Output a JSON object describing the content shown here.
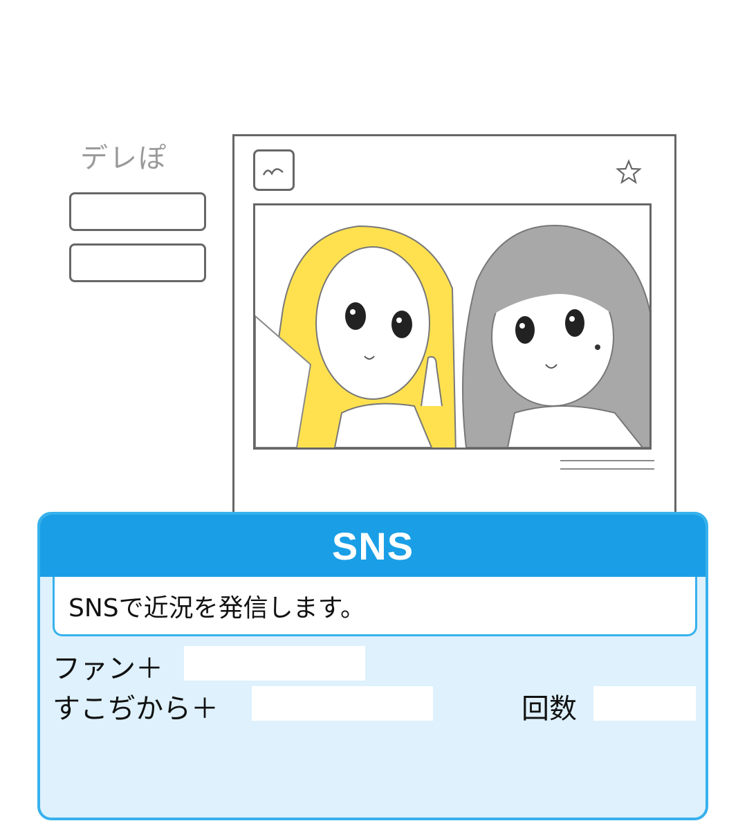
{
  "sketch": {
    "logo_text": "デレぽ"
  },
  "panel": {
    "title": "SNS",
    "description": "SNSで近況を発信します。",
    "fans_label": "ファン＋",
    "fans_value": "",
    "sukoshi_label": "すこぢから＋",
    "sukoshi_value": "",
    "count_label": "回数",
    "count_value": ""
  },
  "colors": {
    "header": "#1a9fe6",
    "border": "#37b1ec",
    "panel_bg": "#def1fc",
    "hair_blonde": "#ffe14f",
    "hair_gray": "#a8a8a8"
  }
}
